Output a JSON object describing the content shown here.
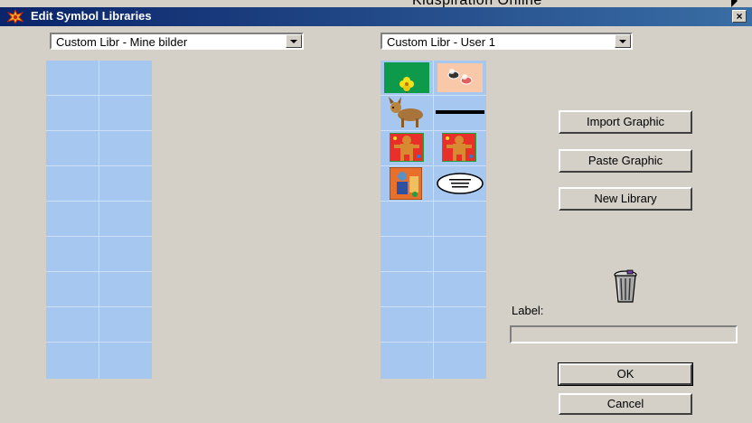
{
  "background_window": {
    "menu_text": "Kidspiration Online"
  },
  "window": {
    "title": "Edit Symbol Libraries",
    "close_glyph": "×"
  },
  "left_library": {
    "selected": "Custom Libr - Mine bilder"
  },
  "right_library": {
    "selected": "Custom Libr - User 1",
    "symbols": [
      "flower-symbol",
      "bees-symbol",
      "dog-symbol",
      "line-symbol",
      "gingerbread-man-symbol",
      "gingerbread-man-symbol",
      "child-drawing-symbol",
      "speech-bubble-symbol"
    ]
  },
  "buttons": {
    "import_graphic": "Import Graphic",
    "paste_graphic": "Paste Graphic",
    "new_library": "New Library",
    "ok": "OK",
    "cancel": "Cancel"
  },
  "label": {
    "caption": "Label:",
    "value": ""
  }
}
